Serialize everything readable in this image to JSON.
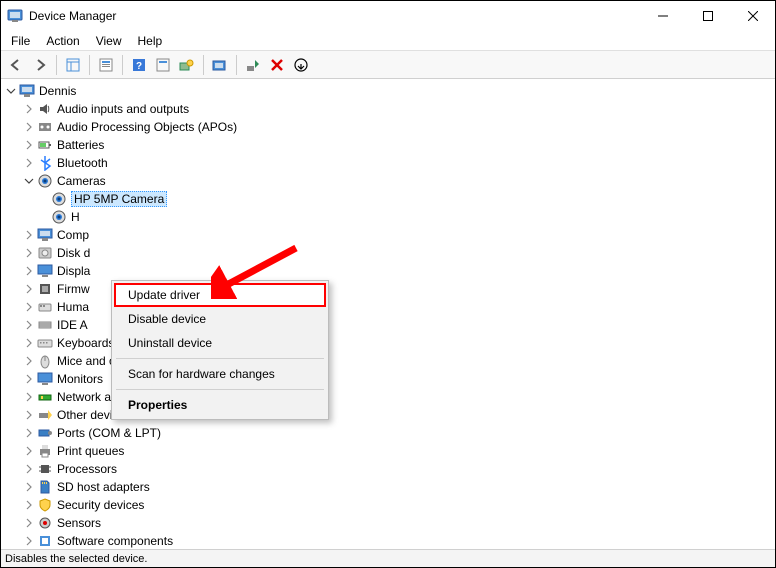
{
  "window": {
    "title": "Device Manager"
  },
  "menu": {
    "file": "File",
    "action": "Action",
    "view": "View",
    "help": "Help"
  },
  "tree": {
    "root": "Dennis",
    "cameras_child1": "HP 5MP Camera",
    "cameras_child2_trunc": "H",
    "items": [
      "Audio inputs and outputs",
      "Audio Processing Objects (APOs)",
      "Batteries",
      "Bluetooth",
      "Cameras",
      "Comp",
      "Disk d",
      "Displa",
      "Firmw",
      "Huma",
      "IDE A",
      "Keyboards",
      "Mice and other pointing devices",
      "Monitors",
      "Network adapters",
      "Other devices",
      "Ports (COM & LPT)",
      "Print queues",
      "Processors",
      "SD host adapters",
      "Security devices",
      "Sensors",
      "Software components"
    ]
  },
  "context_menu": {
    "update": "Update driver",
    "disable": "Disable device",
    "uninstall": "Uninstall device",
    "scan": "Scan for hardware changes",
    "properties": "Properties"
  },
  "status": "Disables the selected device."
}
